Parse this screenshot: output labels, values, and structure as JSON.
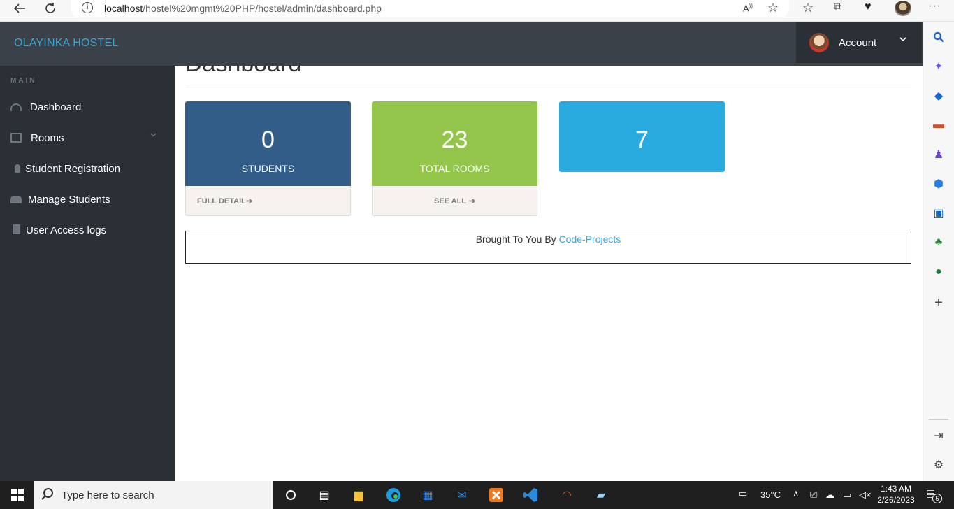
{
  "browser": {
    "url_host": "localhost",
    "url_path": "/hostel%20mgmt%20PHP/hostel/admin/dashboard.php"
  },
  "header": {
    "brand": "OLAYINKA HOSTEL",
    "account_label": "Account"
  },
  "sidebar": {
    "caption": "MAIN",
    "items": [
      {
        "label": "Dashboard",
        "icon": "dashboard-icon"
      },
      {
        "label": "Rooms",
        "icon": "desktop-icon"
      },
      {
        "label": "Student Registration",
        "icon": "user-icon"
      },
      {
        "label": "Manage Students",
        "icon": "users-icon"
      },
      {
        "label": "User Access logs",
        "icon": "file-icon"
      }
    ]
  },
  "main": {
    "title": "Dashboard",
    "cards": [
      {
        "value": "0",
        "label": "STUDENTS",
        "link": "FULL DETAIL",
        "color": "#325d88"
      },
      {
        "value": "23",
        "label": "TOTAL ROOMS",
        "link": "SEE ALL",
        "color": "#93c54b"
      },
      {
        "value": "7",
        "label": "",
        "link": "",
        "color": "#29abe0"
      }
    ],
    "footer_text": "Brought To You By ",
    "footer_link": "Code-Projects"
  },
  "taskbar": {
    "search_placeholder": "Type here to search",
    "temperature": "35°C",
    "time": "1:43 AM",
    "date": "2/26/2023",
    "notification_count": "5"
  }
}
